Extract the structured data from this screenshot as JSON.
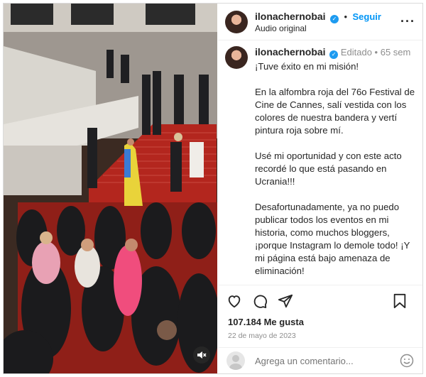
{
  "post": {
    "username": "ilonachernobai",
    "verified_badge": "✓",
    "follow_label": "Seguir",
    "audio_label": "Audio original",
    "edited_label": "Editado",
    "separator": "•",
    "time_ago": "65 sem",
    "caption": "¡Tuve éxito en mi misión!\n\nEn la alfombra roja del 76o Festival de Cine de Cannes, salí vestida con los colores de nuestra bandera y vertí pintura roja sobre mí.\n\nUsé mi oportunidad y con este acto recordé lo que está pasando en Ucrania!!!\n\nDesafortunadamente, ya no puedo publicar todos los eventos en mi historia, como muchos bloggers, ¡porque Instagram lo demole todo! ¡Y mi página está bajo amenaza de eliminación!\n\n¡Estoy muy contento de que mi obra",
    "likes": "107.184 Me gusta",
    "date": "22 de mayo de 2023",
    "comment_placeholder": "Agrega un comentario..."
  },
  "icons": {
    "more": "more-options-icon",
    "like": "heart-icon",
    "comment": "comment-icon",
    "share": "send-icon",
    "save": "bookmark-icon",
    "mute": "speaker-muted-icon",
    "emoji": "emoji-icon"
  },
  "colors": {
    "link_blue": "#0095f6",
    "verified_blue": "#1d9bf0",
    "muted_gray": "#8e8e8e",
    "red_carpet": "#b3261e"
  }
}
